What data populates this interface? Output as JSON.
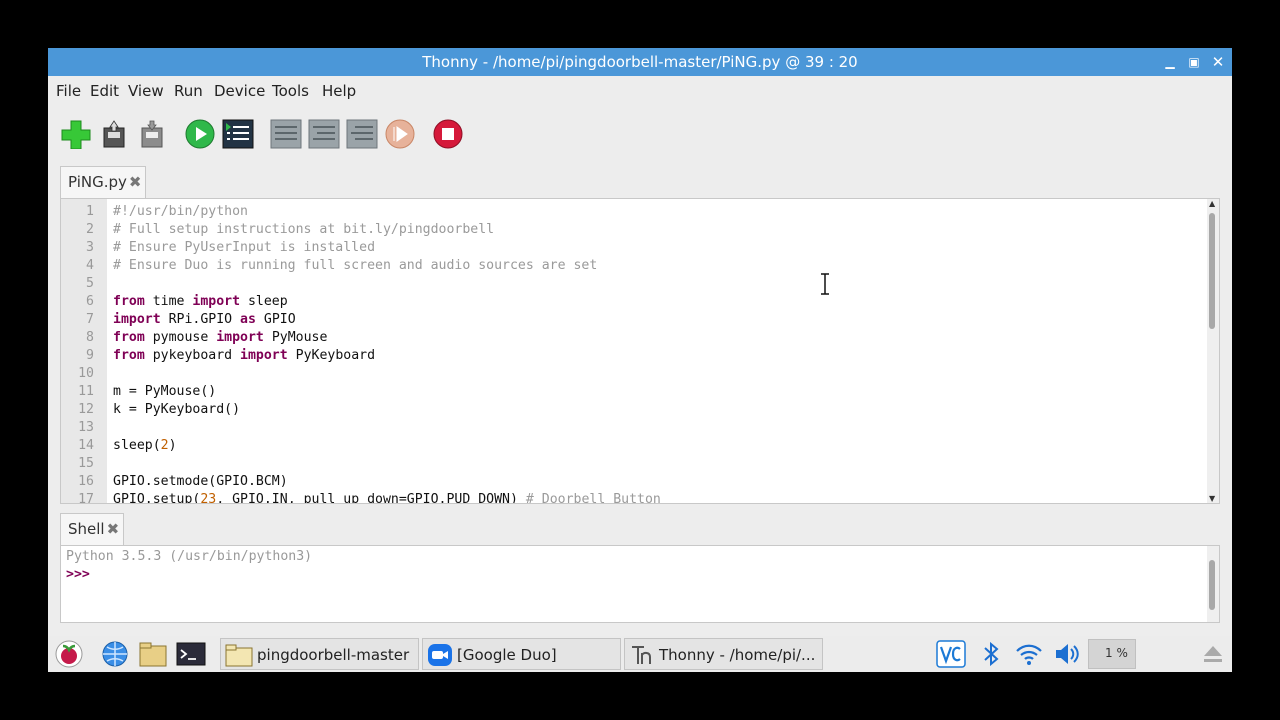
{
  "window": {
    "title": "Thonny  -  /home/pi/pingdoorbell-master/PiNG.py  @  39 : 20",
    "controls": [
      "minimize-icon",
      "maximize-icon",
      "close-icon"
    ]
  },
  "menu": [
    "File",
    "Edit",
    "View",
    "Run",
    "Device",
    "Tools",
    "Help"
  ],
  "toolbar": [
    "new-file-icon",
    "open-file-icon",
    "save-file-icon",
    "run-icon",
    "debug-icon",
    "step-over-icon",
    "step-into-icon",
    "step-out-icon",
    "resume-icon",
    "stop-icon"
  ],
  "editor": {
    "tab": {
      "label": "PiNG.py",
      "close": "✖"
    },
    "lines": [
      {
        "n": "1",
        "parts": [
          {
            "t": "#!/usr/bin/python",
            "c": "cm"
          }
        ]
      },
      {
        "n": "2",
        "parts": [
          {
            "t": "# Full setup instructions at bit.ly/pingdoorbell",
            "c": "cm"
          }
        ]
      },
      {
        "n": "3",
        "parts": [
          {
            "t": "# Ensure PyUserInput is installed",
            "c": "cm"
          }
        ]
      },
      {
        "n": "4",
        "parts": [
          {
            "t": "# Ensure Duo is running full screen and audio sources are set",
            "c": "cm"
          }
        ]
      },
      {
        "n": "5",
        "parts": []
      },
      {
        "n": "6",
        "parts": [
          {
            "t": "from",
            "c": "kw"
          },
          {
            "t": " time ",
            "c": ""
          },
          {
            "t": "import",
            "c": "kw"
          },
          {
            "t": " sleep",
            "c": ""
          }
        ]
      },
      {
        "n": "7",
        "parts": [
          {
            "t": "import",
            "c": "kw"
          },
          {
            "t": " RPi.GPIO ",
            "c": ""
          },
          {
            "t": "as",
            "c": "kw"
          },
          {
            "t": " GPIO",
            "c": ""
          }
        ]
      },
      {
        "n": "8",
        "parts": [
          {
            "t": "from",
            "c": "kw"
          },
          {
            "t": " pymouse ",
            "c": ""
          },
          {
            "t": "import",
            "c": "kw"
          },
          {
            "t": " PyMouse",
            "c": ""
          }
        ]
      },
      {
        "n": "9",
        "parts": [
          {
            "t": "from",
            "c": "kw"
          },
          {
            "t": " pykeyboard ",
            "c": ""
          },
          {
            "t": "import",
            "c": "kw"
          },
          {
            "t": " PyKeyboard",
            "c": ""
          }
        ]
      },
      {
        "n": "10",
        "parts": []
      },
      {
        "n": "11",
        "parts": [
          {
            "t": "m = PyMouse()",
            "c": ""
          }
        ]
      },
      {
        "n": "12",
        "parts": [
          {
            "t": "k = PyKeyboard()",
            "c": ""
          }
        ]
      },
      {
        "n": "13",
        "parts": []
      },
      {
        "n": "14",
        "parts": [
          {
            "t": "sleep(",
            "c": ""
          },
          {
            "t": "2",
            "c": "num"
          },
          {
            "t": ")",
            "c": ""
          }
        ]
      },
      {
        "n": "15",
        "parts": []
      },
      {
        "n": "16",
        "parts": [
          {
            "t": "GPIO.setmode(GPIO.BCM)",
            "c": ""
          }
        ]
      },
      {
        "n": "17",
        "parts": [
          {
            "t": "GPIO.setup(",
            "c": ""
          },
          {
            "t": "23",
            "c": "num"
          },
          {
            "t": ", GPIO.IN, pull_up_down=GPIO.PUD_DOWN) ",
            "c": ""
          },
          {
            "t": "# Doorbell Button",
            "c": "cm"
          }
        ]
      }
    ]
  },
  "shell": {
    "tab": {
      "label": "Shell",
      "close": "✖"
    },
    "lines": [
      {
        "t": "Python 3.5.3 (/usr/bin/python3)",
        "color": "#999999"
      },
      {
        "t": ">>>",
        "color": "#7f0055"
      }
    ]
  },
  "taskbar": {
    "launchers": [
      "raspberry-menu-icon",
      "web-browser-icon",
      "file-manager-icon",
      "terminal-icon"
    ],
    "windows": [
      {
        "label": "pingdoorbell-master",
        "icon": "folder-icon"
      },
      {
        "label": "[Google Duo]",
        "icon": "duo-icon"
      },
      {
        "label": "Thonny  -  /home/pi/...",
        "icon": "thonny-icon"
      }
    ],
    "tray": {
      "cpu": "1 %",
      "icons": [
        "vnc-icon",
        "bluetooth-icon",
        "wifi-icon",
        "volume-icon",
        "cpu-monitor-icon",
        "eject-icon"
      ]
    }
  }
}
